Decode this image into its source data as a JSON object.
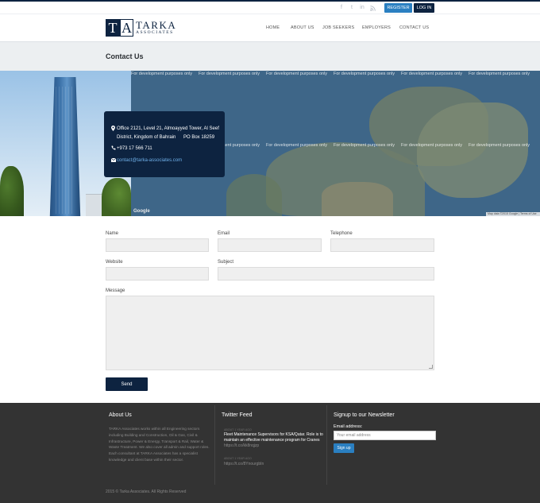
{
  "topbar": {
    "social_icons": [
      "facebook-icon",
      "twitter-icon",
      "linkedin-icon",
      "rss-icon"
    ],
    "register_label": "REGISTER",
    "login_label": "LOG IN"
  },
  "header": {
    "logo_letters": [
      "T",
      "A"
    ],
    "logo_name": "TARKA",
    "logo_sub": "ASSOCIATES",
    "nav": [
      {
        "label": "HOME"
      },
      {
        "label": "ABOUT US"
      },
      {
        "label": "JOB SEEKERS"
      },
      {
        "label": "EMPLOYERS"
      },
      {
        "label": "CONTACT US"
      }
    ]
  },
  "page": {
    "title": "Contact Us"
  },
  "map": {
    "watermark": "For development purposes only",
    "google_label": "Google",
    "credit": "Map data ©2015 Google | Terms of Use"
  },
  "contact_card": {
    "address_line1": "Office 2121, Level 21, Almoayyed Tower, Al Seef",
    "address_line2": "District, Kingdom of Bahrain",
    "po_box": "PO Box 18259",
    "phone": "+973 17 566 711",
    "email": "contact@tarka-associates.com"
  },
  "form": {
    "name_label": "Name",
    "email_label": "Email",
    "telephone_label": "Telephone",
    "website_label": "Website",
    "subject_label": "Subject",
    "message_label": "Message",
    "send_label": "Send"
  },
  "footer": {
    "about_title": "About Us",
    "about_text": "TARKA Associates works within all Engineering sectors including Building and Construction, Oil & Gas, Civil & Infrastructure, Power & Energy, Transport & Rail, Water & Waste Treatment. We also cover all admin and support roles. Each consultant at TARKA Associates has a specialist knowledge and client base within their sector.",
    "twitter_title": "Twitter Feed",
    "tweets": [
      {
        "time": "ABOUT 1 YEAR AGO",
        "text": "Fleet Maintenance Supervisors for KSA/Qatar. Role is to maintain an effective maintenance program for Cranes",
        "link": "https://t.co/kk8nqjzp"
      },
      {
        "time": "ABOUT 1 YEAR AGO",
        "link": "https://t.co/8YnourgbIn"
      }
    ],
    "newsletter_title": "Signup to our Newsletter",
    "email_address_label": "Email address:",
    "email_placeholder": "Your email address",
    "signup_label": "Sign up",
    "copyright": "2015 © Tarka Associates. All Rights Reserved"
  },
  "colors": {
    "navy": "#0d2340",
    "accent_blue": "#2a7fc1",
    "footer_bg": "#333333",
    "title_band": "#eceff1"
  }
}
